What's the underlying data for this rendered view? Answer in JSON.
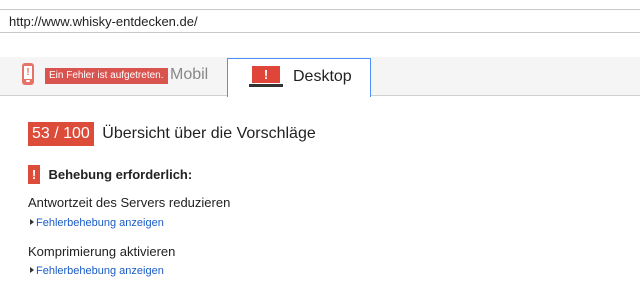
{
  "url_bar": {
    "value": "http://www.whisky-entdecken.de/"
  },
  "tabs": {
    "mobil": {
      "error_badge": "Ein Fehler ist aufgetreten.",
      "label": "Mobil",
      "icon": "phone-icon"
    },
    "desktop": {
      "label": "Desktop",
      "icon": "monitor-icon"
    }
  },
  "score": {
    "value": "53 / 100",
    "title": "Übersicht über die Vorschläge"
  },
  "fix_required": {
    "label": "Behebung erforderlich:",
    "icon_glyph": "!"
  },
  "rules": [
    {
      "title": "Antwortzeit des Servers reduzieren",
      "link": "Fehlerbehebung anzeigen"
    },
    {
      "title": "Komprimierung aktivieren",
      "link": "Fehlerbehebung anzeigen"
    }
  ],
  "colors": {
    "error_red": "#dd4b39",
    "link_blue": "#1a5bc4",
    "tab_border_blue": "#4d90fe"
  }
}
